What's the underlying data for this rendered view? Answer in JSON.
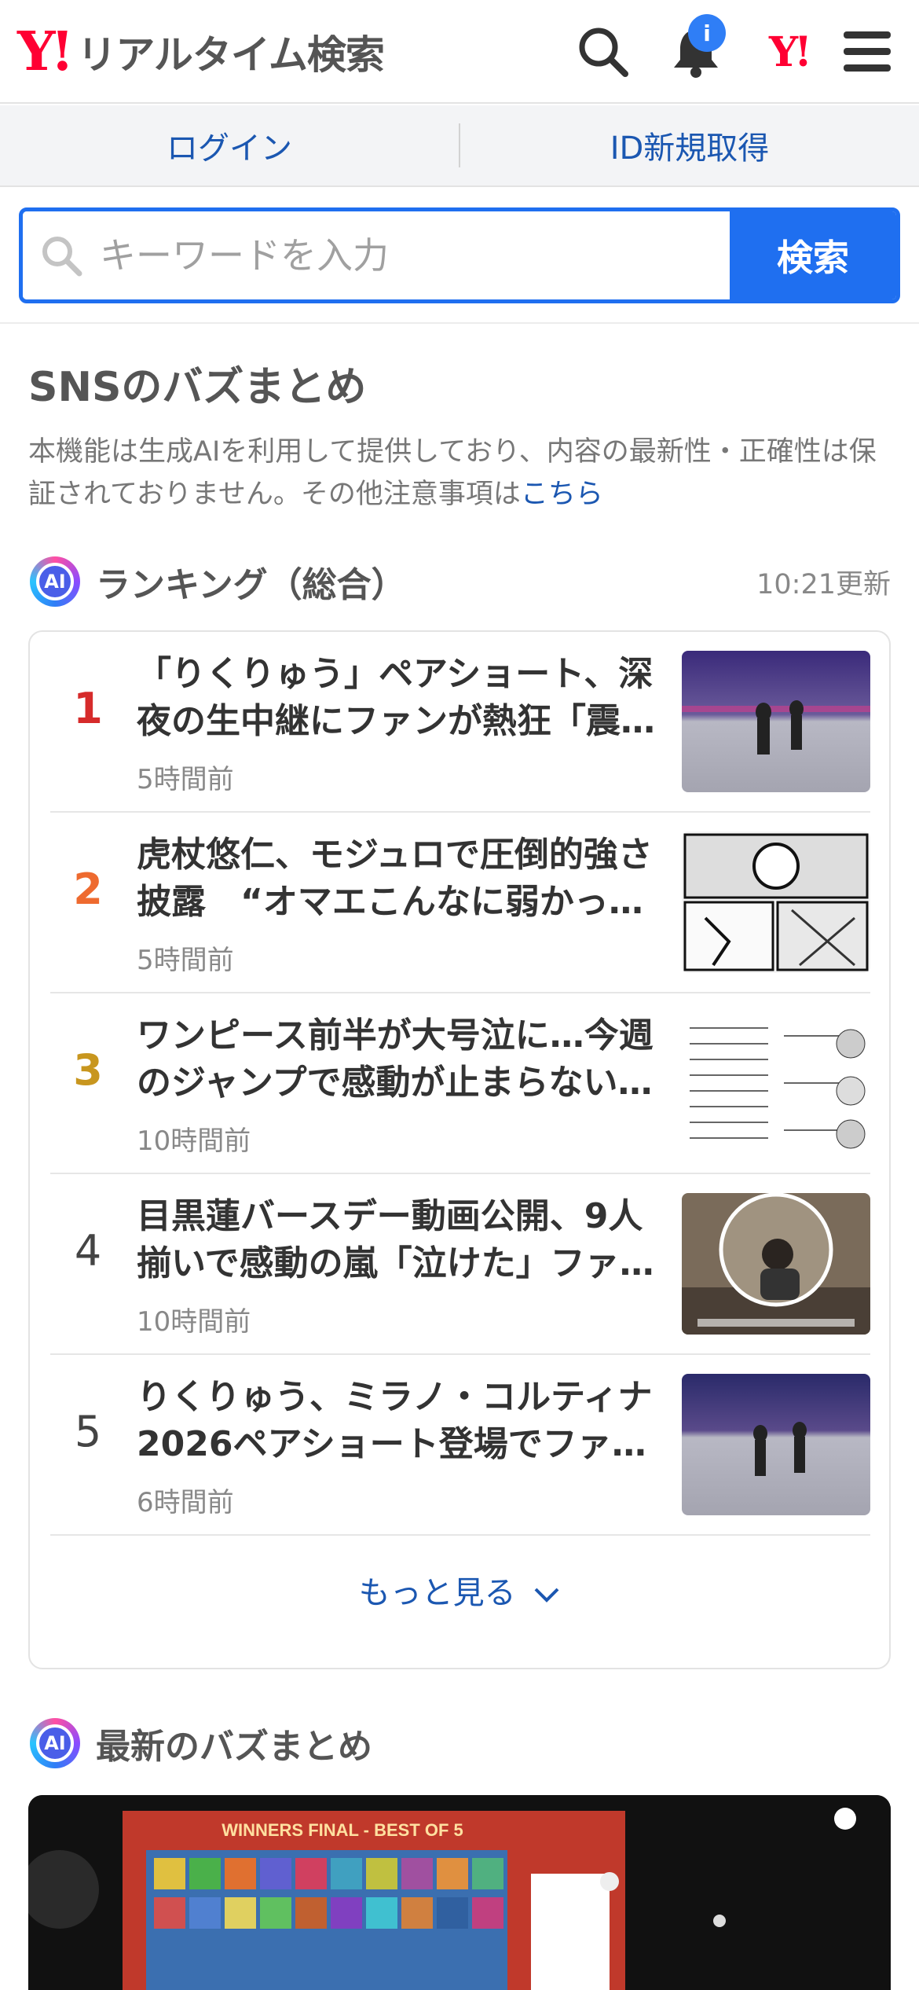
{
  "header": {
    "logo_mark": "Y!",
    "logo_text": "リアルタイム検索",
    "notification_badge": "i",
    "yahoo_mini": "Y!"
  },
  "loginbar": {
    "login": "ログイン",
    "register": "ID新規取得"
  },
  "search": {
    "placeholder": "キーワードを入力",
    "button": "検索"
  },
  "buzz": {
    "title": "SNSのバズまとめ",
    "note_text": "本機能は生成AIを利用して提供しており、内容の最新性・正確性は保証されておりません。その他注意事項は",
    "note_link": "こちら",
    "ai_label": "AI"
  },
  "ranking": {
    "title": "ランキング（総合）",
    "updated": "10:21更新",
    "items": [
      {
        "rank": "1",
        "title": "「りくりゅう」ペアショート、深夜の生中継にファンが熱狂「震…",
        "time": "5時間前",
        "color": "#d62b2b"
      },
      {
        "rank": "2",
        "title": "虎杖悠仁、モジュロで圧倒的強さ披露　“オマエこんなに弱かっ…",
        "time": "5時間前",
        "color": "#ee6a2f"
      },
      {
        "rank": "3",
        "title": "ワンピース前半が大号泣に…今週のジャンプで感動が止まらない…",
        "time": "10時間前",
        "color": "#c8961e"
      },
      {
        "rank": "4",
        "title": "目黒蓮バースデー動画公開、9人揃いで感動の嵐「泣けた」ファ…",
        "time": "10時間前",
        "color": "#444444"
      },
      {
        "rank": "5",
        "title": "りくりゅう、ミラノ・コルティナ2026ペアショート登場でファ…",
        "time": "6時間前",
        "color": "#444444"
      }
    ],
    "more": "もっと見る"
  },
  "latest": {
    "title": "最新のバズまとめ",
    "hero_caption": "WINNERS FINAL - BEST OF 5"
  }
}
